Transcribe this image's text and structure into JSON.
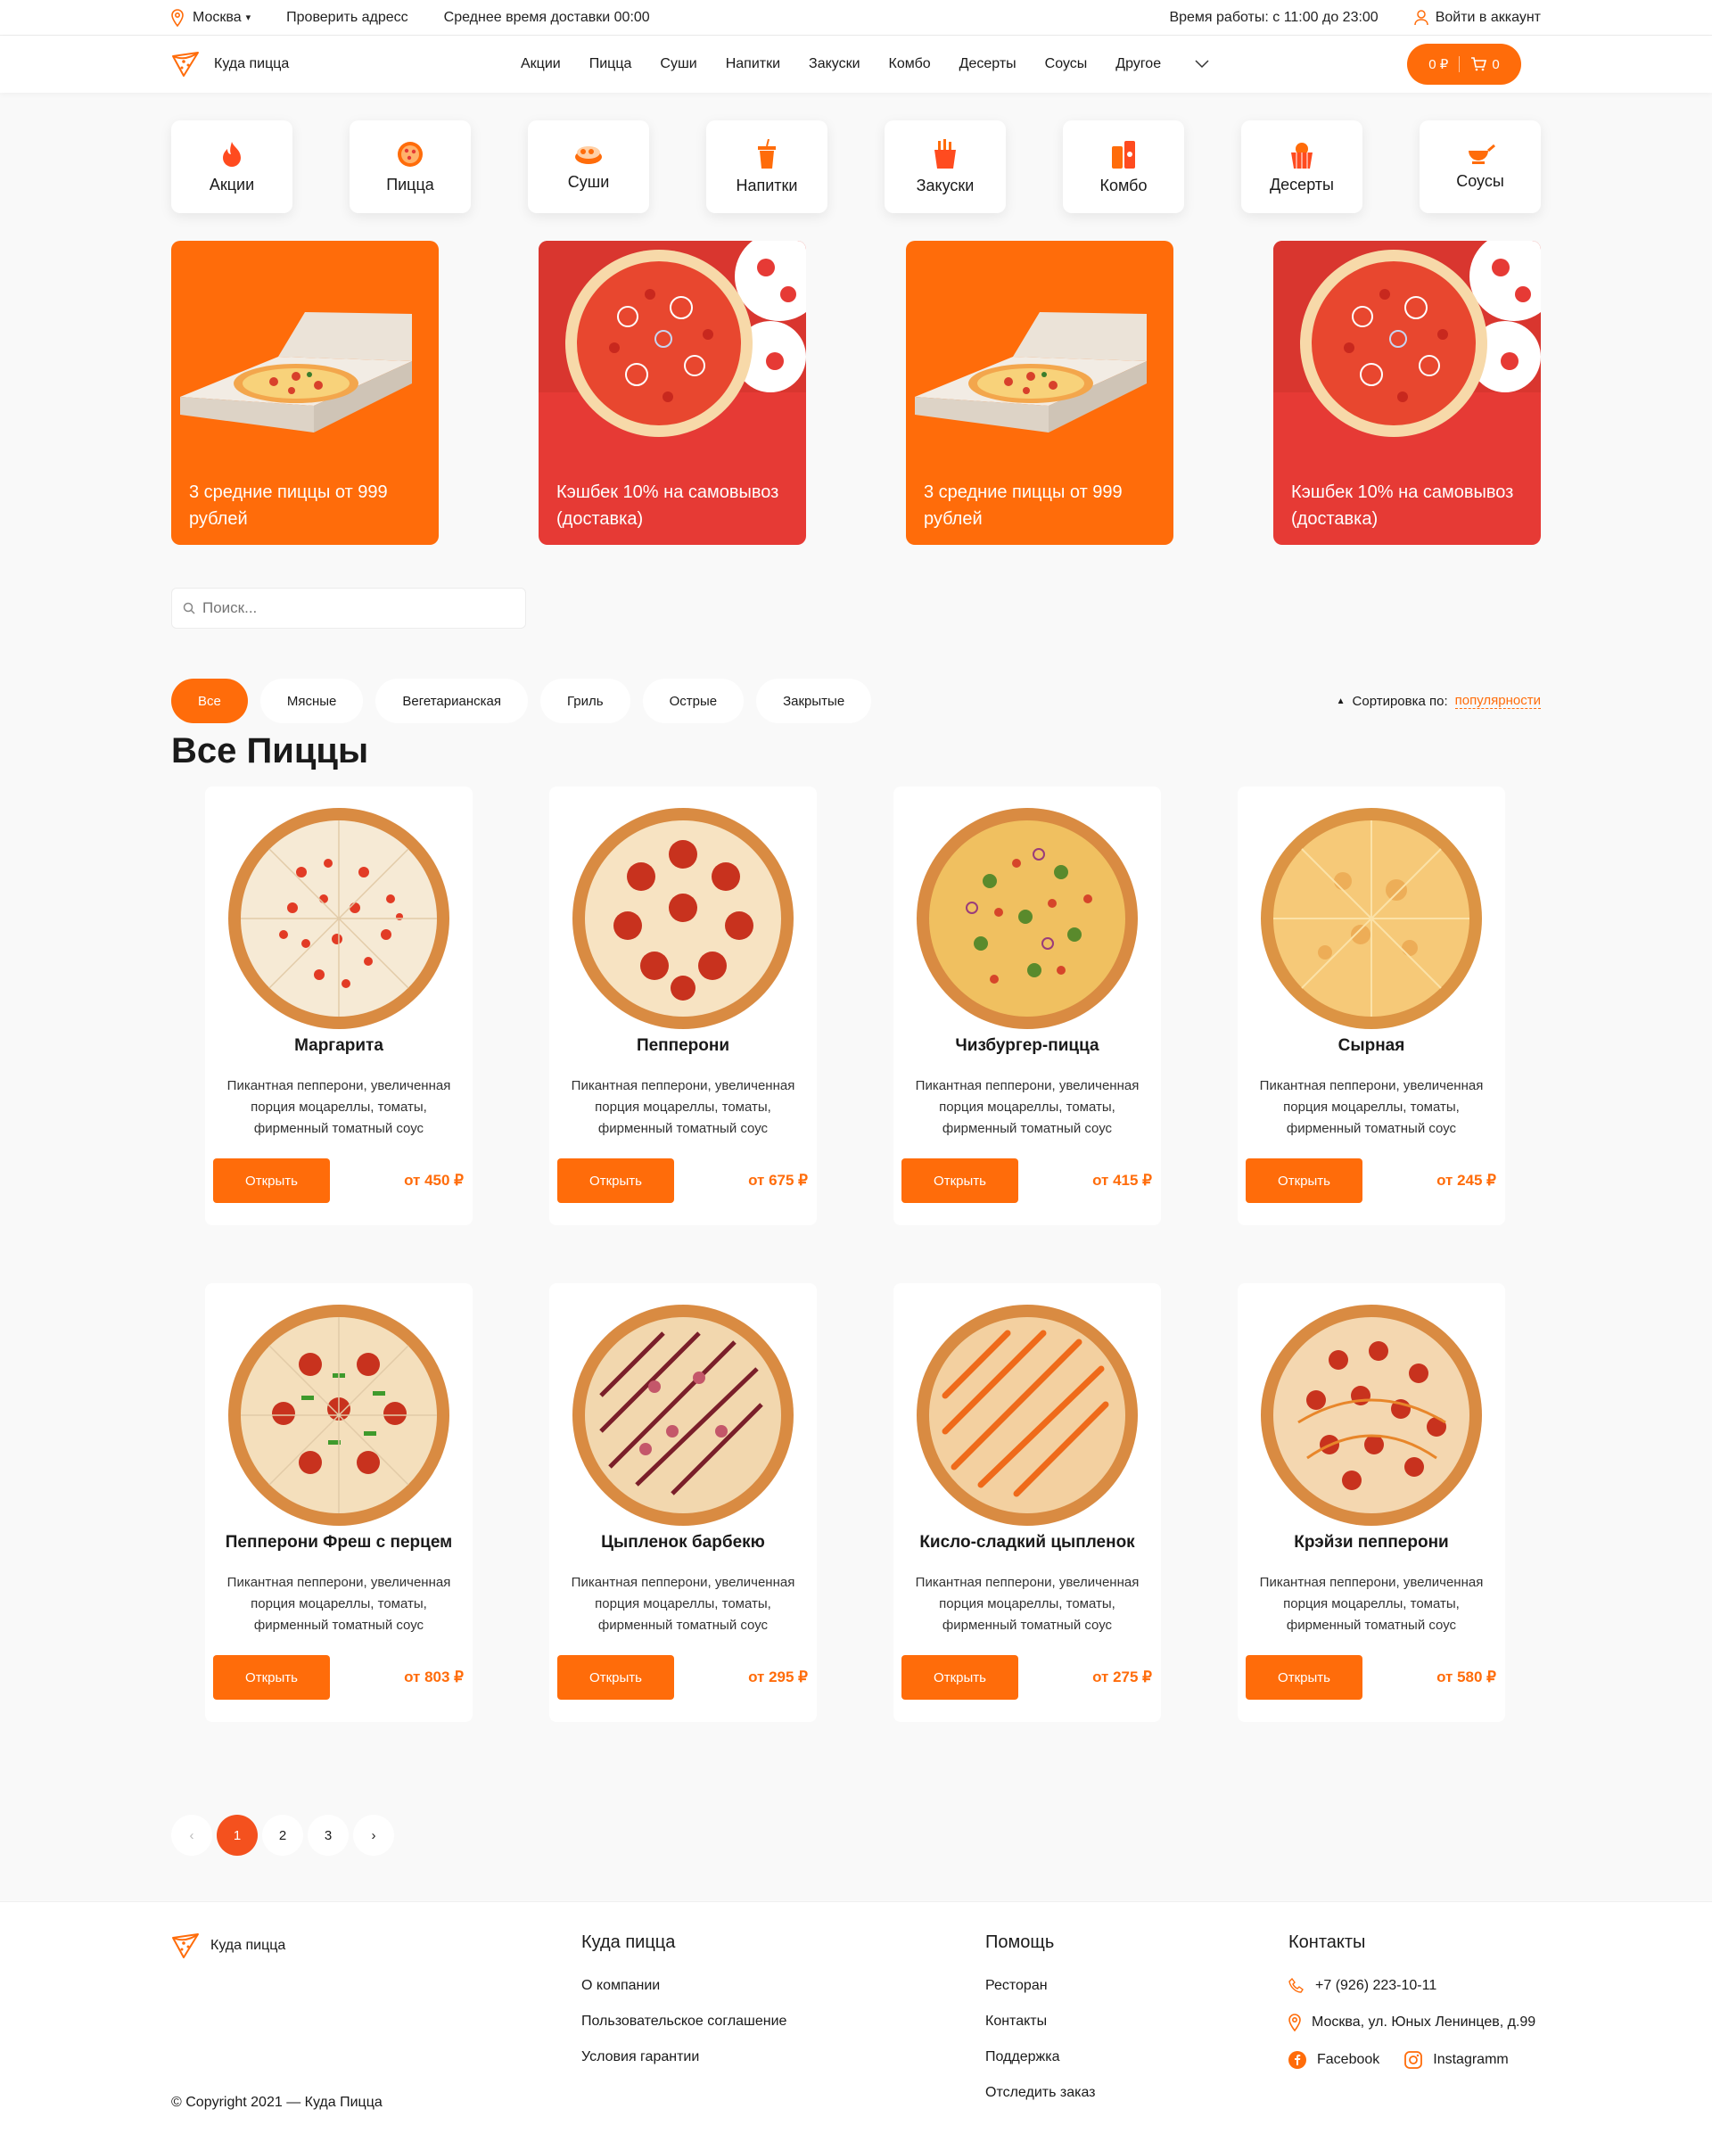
{
  "topbar": {
    "city": "Москва",
    "check_address": "Проверить адресс",
    "delivery_time": "Среднее время доставки 00:00",
    "work_hours": "Время работы: с 11:00 до 23:00",
    "login": "Войти в аккаунт"
  },
  "header": {
    "logo": "Куда пицца",
    "nav": [
      "Акции",
      "Пицца",
      "Суши",
      "Напитки",
      "Закуски",
      "Комбо",
      "Десерты",
      "Соусы"
    ],
    "nav_other": "Другое",
    "cart_sum": "0 ₽",
    "cart_count": "0"
  },
  "categories": [
    {
      "label": "Акции",
      "icon": "flame-icon"
    },
    {
      "label": "Пицца",
      "icon": "pizza-icon"
    },
    {
      "label": "Суши",
      "icon": "sushi-icon"
    },
    {
      "label": "Напитки",
      "icon": "drink-icon"
    },
    {
      "label": "Закуски",
      "icon": "fries-icon"
    },
    {
      "label": "Комбо",
      "icon": "combo-icon"
    },
    {
      "label": "Десерты",
      "icon": "dessert-icon"
    },
    {
      "label": "Соусы",
      "icon": "sauce-icon"
    }
  ],
  "banners": [
    {
      "text": "3 средние пиццы от 999 рублей"
    },
    {
      "text": "Кэшбек 10% на самовывоз (доставка)"
    },
    {
      "text": "3 средние пиццы от 999 рублей"
    },
    {
      "text": "Кэшбек 10% на самовывоз (доставка)"
    }
  ],
  "search": {
    "placeholder": "Поиск..."
  },
  "filters": [
    "Все",
    "Мясные",
    "Вегетарианская",
    "Гриль",
    "Острые",
    "Закрытые"
  ],
  "sort": {
    "label": "Сортировка по:",
    "value": "популярности"
  },
  "section_title": "Все Пиццы",
  "products": [
    {
      "name": "Маргарита",
      "desc": "Пикантная пепперони, увеличенная порция моцареллы, томаты, фирменный томатный соус",
      "price": "от 450 ₽",
      "button": "Открыть"
    },
    {
      "name": "Пепперони",
      "desc": "Пикантная пепперони, увеличенная порция моцареллы, томаты, фирменный томатный соус",
      "price": "от 675 ₽",
      "button": "Открыть"
    },
    {
      "name": "Чизбургер-пицца",
      "desc": "Пикантная пепперони, увеличенная порция моцареллы, томаты, фирменный томатный соус",
      "price": "от 415 ₽",
      "button": "Открыть"
    },
    {
      "name": "Сырная",
      "desc": "Пикантная пепперони, увеличенная порция моцареллы, томаты, фирменный томатный соус",
      "price": "от 245 ₽",
      "button": "Открыть"
    },
    {
      "name": "Пепперони Фреш с перцем",
      "desc": "Пикантная пепперони, увеличенная порция моцареллы, томаты, фирменный томатный соус",
      "price": "от 803 ₽",
      "button": "Открыть"
    },
    {
      "name": "Цыпленок барбекю",
      "desc": "Пикантная пепперони, увеличенная порция моцареллы, томаты, фирменный томатный соус",
      "price": "от 295 ₽",
      "button": "Открыть"
    },
    {
      "name": "Кисло-сладкий цыпленок",
      "desc": "Пикантная пепперони, увеличенная порция моцареллы, томаты, фирменный томатный соус",
      "price": "от 275 ₽",
      "button": "Открыть"
    },
    {
      "name": "Крэйзи пепперони",
      "desc": "Пикантная пепперони, увеличенная порция моцареллы, томаты, фирменный томатный соус",
      "price": "от 580 ₽",
      "button": "Открыть"
    }
  ],
  "pagination": {
    "prev": "‹",
    "pages": [
      "1",
      "2",
      "3"
    ],
    "next": "›",
    "current": "1"
  },
  "footer": {
    "logo": "Куда пицца",
    "col1_title": "Куда пицца",
    "col1": [
      "О компании",
      "Пользовательское соглашение",
      "Условия гарантии"
    ],
    "col2_title": "Помощь",
    "col2": [
      "Ресторан",
      "Контакты",
      "Поддержка",
      "Отследить заказ"
    ],
    "col3_title": "Контакты",
    "phone": "+7 (926) 223-10-11",
    "address": "Москва, ул. Юных Ленинцев, д.99",
    "facebook": "Facebook",
    "instagram": "Instagramm",
    "copyright": "© Copyright 2021 — Куда Пицца"
  },
  "colors": {
    "accent": "#ff6c0a",
    "banner_red": "#e63a35",
    "background": "#f9f9f9"
  }
}
